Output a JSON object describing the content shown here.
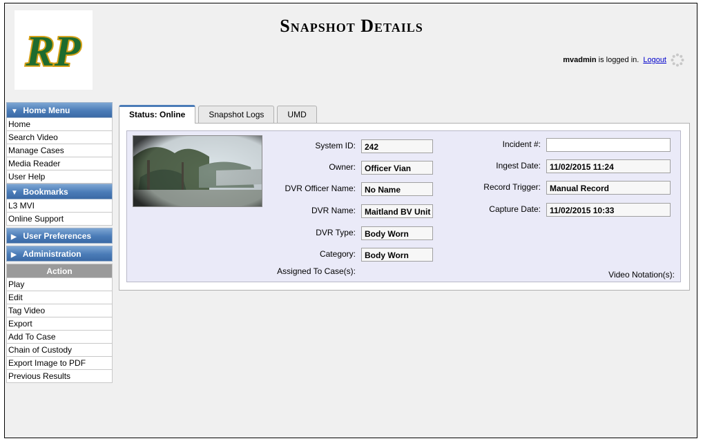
{
  "header": {
    "title": "Snapshot Details",
    "logo_text": "RP",
    "username": "mvadmin",
    "logged_in_suffix": " is logged in.",
    "logout_label": "Logout"
  },
  "sidebar": {
    "home_menu": {
      "title": "Home Menu",
      "items": [
        "Home",
        "Search Video",
        "Manage Cases",
        "Media Reader",
        "User Help"
      ]
    },
    "bookmarks": {
      "title": "Bookmarks",
      "items": [
        "L3 MVI",
        "Online Support"
      ]
    },
    "user_preferences": {
      "title": "User Preferences"
    },
    "administration": {
      "title": "Administration"
    },
    "action": {
      "title": "Action",
      "items": [
        "Play",
        "Edit",
        "Tag Video",
        "Export",
        "Add To Case",
        "Chain of Custody",
        "Export Image to PDF",
        "Previous Results"
      ]
    }
  },
  "tabs": [
    {
      "label": "Status: Online",
      "active": true
    },
    {
      "label": "Snapshot Logs",
      "active": false
    },
    {
      "label": "UMD",
      "active": false
    }
  ],
  "details": {
    "system_id": {
      "label": "System ID:",
      "value": "242"
    },
    "owner": {
      "label": "Owner:",
      "value": "Officer Vian"
    },
    "dvr_officer_name": {
      "label": "DVR Officer Name:",
      "value": "No Name"
    },
    "dvr_name": {
      "label": "DVR Name:",
      "value": "Maitland BV Unit"
    },
    "dvr_type": {
      "label": "DVR Type:",
      "value": "Body Worn"
    },
    "category": {
      "label": "Category:",
      "value": "Body Worn"
    },
    "assigned_to_cases": {
      "label": "Assigned To Case(s):"
    },
    "incident": {
      "label": "Incident #:",
      "value": ""
    },
    "ingest_date": {
      "label": "Ingest Date:",
      "value": "11/02/2015 11:24"
    },
    "record_trigger": {
      "label": "Record Trigger:",
      "value": "Manual Record"
    },
    "capture_date": {
      "label": "Capture Date:",
      "value": "11/02/2015 10:33"
    },
    "video_notations": {
      "label": "Video Notation(s):"
    }
  },
  "colors": {
    "menu_header": "#4a7bb7",
    "logo_green": "#1e6b2e",
    "logo_gold": "#d4a017",
    "details_bg": "#eaeaf8"
  }
}
